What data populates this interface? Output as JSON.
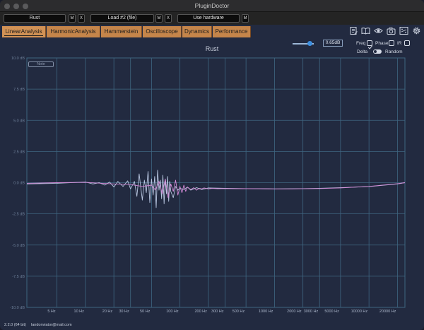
{
  "window": {
    "title": "PluginDoctor"
  },
  "plugins": {
    "slot1": "Rust",
    "slot2": "Load #2 (file)",
    "slot3": "Use hardware",
    "m_label": "M",
    "x_label": "X"
  },
  "tabs": [
    {
      "label": "LinearAnalysis",
      "active": true
    },
    {
      "label": "HarmonicAnalysis",
      "active": false
    },
    {
      "label": "Hammerstein",
      "active": false
    },
    {
      "label": "Oscilloscope",
      "active": false
    },
    {
      "label": "Dynamics",
      "active": false
    },
    {
      "label": "Performance",
      "active": false
    }
  ],
  "toolbar_icons": [
    "notes-icon",
    "book-icon",
    "eye-icon",
    "camera-icon",
    "fraction-icon",
    "gear-icon"
  ],
  "controls": {
    "volume_fraction": 0.8,
    "volume_value": "0.65dB",
    "freq_label": "Freq",
    "freq_checked": true,
    "phase_label": "Phase",
    "phase_checked": false,
    "ir_label": "IR",
    "ir_checked": false,
    "delta_label": "Delta",
    "random_label": "Random"
  },
  "note_label": "Note",
  "status": {
    "version": "2.2.0 (64 bit)",
    "email": "landonviator@mail.com"
  },
  "colors": {
    "background": "#222a40",
    "grid": "#3f6681",
    "tab": "#c5854a",
    "series_left": "#b8c6e0",
    "series_right": "#d58ad8"
  },
  "chart_data": {
    "type": "line",
    "title": "Rust",
    "x_scale": "log",
    "xlim": [
      2.4,
      24000
    ],
    "ylim": [
      -10.0,
      10.0
    ],
    "x_ticks": [
      5,
      10,
      20,
      30,
      50,
      100,
      200,
      300,
      500,
      1000,
      2000,
      3000,
      5000,
      10000,
      20000
    ],
    "x_tick_labels": [
      "5 Hz",
      "10 Hz",
      "20 Hz",
      "30 Hz",
      "50 Hz",
      "100 Hz",
      "200 Hz",
      "300 Hz",
      "500 Hz",
      "1000 Hz",
      "2000 Hz",
      "3000 Hz",
      "5000 Hz",
      "10000 Hz",
      "20000 Hz"
    ],
    "y_ticks": [
      -10,
      -7.5,
      -5,
      -2.5,
      0,
      2.5,
      5,
      7.5,
      10
    ],
    "y_tick_labels": [
      "-10.0 dB",
      "-7.5 dB",
      "-5.0 dB",
      "-2.5 dB",
      "0.0 dB",
      "2.5 dB",
      "5.0 dB",
      "7.5 dB",
      "10.0 dB"
    ],
    "grid": true,
    "series": [
      {
        "key": "left",
        "x": [
          2.4,
          5,
          10,
          12,
          14,
          16,
          18,
          20,
          22,
          25,
          28,
          30,
          33,
          35,
          37,
          40,
          42,
          44,
          46,
          48,
          50,
          52,
          54,
          56,
          58,
          60,
          62,
          64,
          66,
          68,
          70,
          72,
          74,
          76,
          78,
          80,
          85,
          90,
          95,
          100,
          110,
          120,
          130,
          150,
          170,
          200,
          300,
          500,
          1000,
          2000,
          3000,
          5000,
          10000,
          20000,
          24000
        ],
        "y": [
          -0.1,
          -0.05,
          0.05,
          -0.1,
          0.0,
          -0.2,
          0.05,
          -0.35,
          0.1,
          -0.3,
          0.15,
          -0.5,
          0.1,
          -1.1,
          0.7,
          -1.4,
          0.2,
          -0.8,
          0.9,
          -1.6,
          0.3,
          -1.0,
          0.5,
          -2.0,
          1.0,
          -0.6,
          0.2,
          -1.3,
          0.6,
          -1.7,
          0.25,
          -0.9,
          0.5,
          -1.5,
          0.1,
          -0.7,
          -1.2,
          -0.3,
          -0.6,
          -0.45,
          -0.55,
          -0.35,
          -0.6,
          -0.4,
          -0.55,
          -0.42,
          -0.45,
          -0.48,
          -0.5,
          -0.48,
          -0.45,
          -0.4,
          -0.32,
          -0.1,
          0.0
        ]
      },
      {
        "key": "right",
        "x": [
          2.4,
          5,
          10,
          20,
          30,
          40,
          50,
          55,
          60,
          65,
          70,
          75,
          80,
          85,
          90,
          95,
          100,
          105,
          110,
          115,
          120,
          130,
          140,
          150,
          160,
          170,
          180,
          200,
          220,
          250,
          300,
          400,
          500,
          700,
          1000,
          1500,
          2000,
          3000,
          5000,
          10000,
          20000,
          24000
        ],
        "y": [
          -0.05,
          0.0,
          0.02,
          -0.1,
          -0.15,
          -0.3,
          -0.2,
          -0.6,
          0.1,
          -0.9,
          0.3,
          -1.2,
          -0.1,
          -0.7,
          0.2,
          -1.0,
          -0.3,
          -0.8,
          -0.2,
          -0.7,
          -0.35,
          -0.55,
          -0.4,
          -0.6,
          -0.45,
          -0.5,
          -0.42,
          -0.5,
          -0.46,
          -0.48,
          -0.47,
          -0.48,
          -0.48,
          -0.49,
          -0.5,
          -0.5,
          -0.49,
          -0.47,
          -0.42,
          -0.3,
          -0.08,
          0.0
        ]
      }
    ]
  }
}
